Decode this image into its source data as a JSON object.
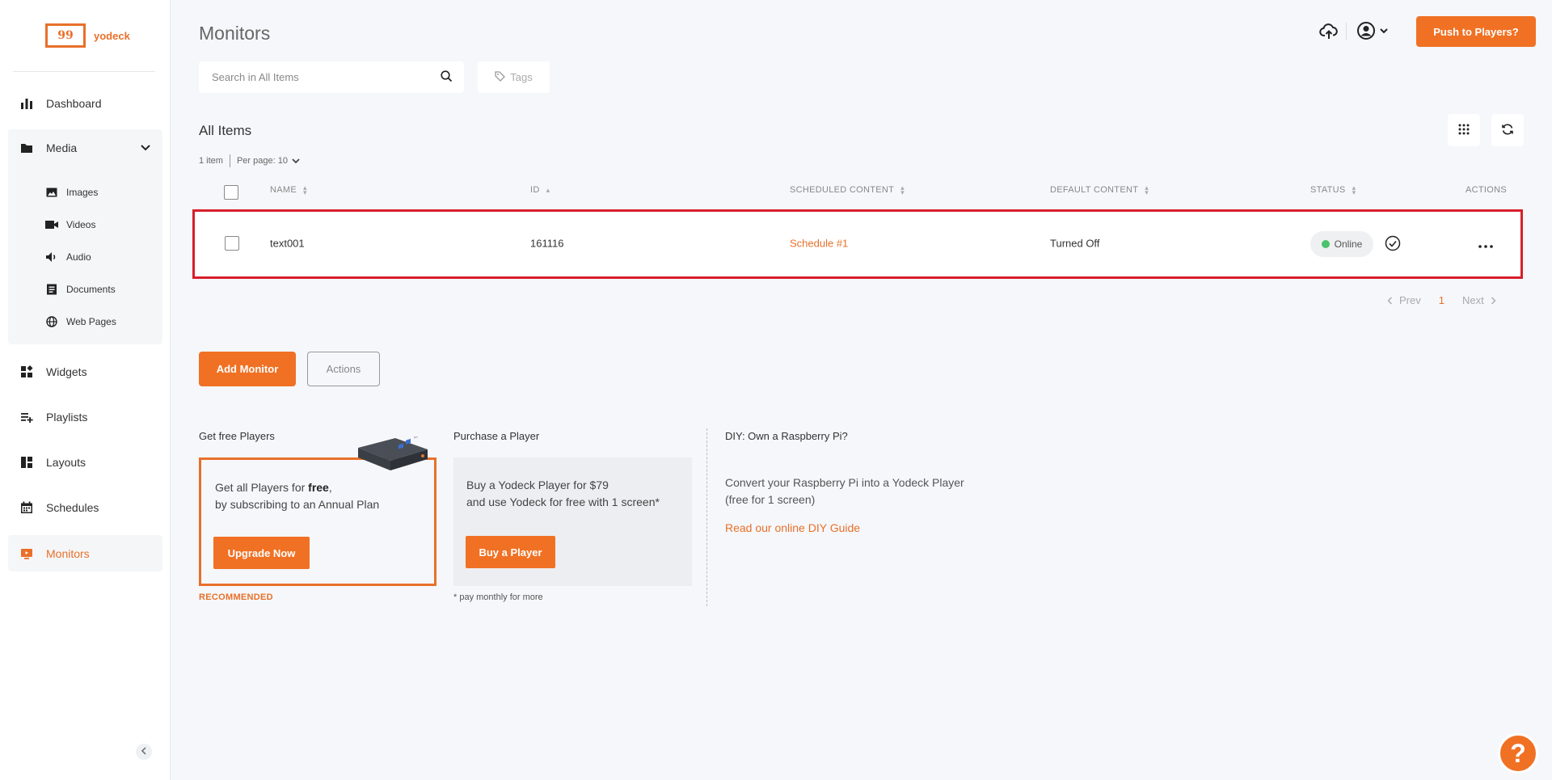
{
  "logo": {
    "mark": "99",
    "text": "yodeck"
  },
  "sidebar": {
    "items": [
      {
        "label": "Dashboard"
      },
      {
        "label": "Media"
      },
      {
        "label": "Widgets"
      },
      {
        "label": "Playlists"
      },
      {
        "label": "Layouts"
      },
      {
        "label": "Schedules"
      },
      {
        "label": "Monitors"
      }
    ],
    "media_sub": [
      {
        "label": "Images"
      },
      {
        "label": "Videos"
      },
      {
        "label": "Audio"
      },
      {
        "label": "Documents"
      },
      {
        "label": "Web Pages"
      }
    ]
  },
  "header": {
    "title": "Monitors",
    "push_label": "Push to Players?"
  },
  "search": {
    "placeholder": "Search in All Items"
  },
  "tags_label": "Tags",
  "list": {
    "title": "All Items",
    "count_text": "1 item",
    "per_page_text": "Per page: 10"
  },
  "table": {
    "headers": {
      "name": "NAME",
      "id": "ID",
      "scheduled": "SCHEDULED CONTENT",
      "default": "DEFAULT CONTENT",
      "status": "STATUS",
      "actions": "ACTIONS"
    },
    "rows": [
      {
        "name": "text001",
        "id": "161116",
        "scheduled": "Schedule #1",
        "default": "Turned Off",
        "status": "Online"
      }
    ]
  },
  "pager": {
    "prev": "Prev",
    "page": "1",
    "next": "Next"
  },
  "buttons": {
    "add_monitor": "Add Monitor",
    "actions": "Actions"
  },
  "promo": {
    "free": {
      "heading": "Get free Players",
      "line1_pre": "Get all Players for ",
      "line1_bold": "free",
      "line1_post": ",",
      "line2": "by subscribing to an Annual Plan",
      "button": "Upgrade Now",
      "badge": "RECOMMENDED"
    },
    "purchase": {
      "heading": "Purchase a Player",
      "line1": "Buy a Yodeck Player for $79",
      "line2": "and use Yodeck for free with 1 screen*",
      "button": "Buy a Player",
      "footnote": "* pay monthly for more"
    },
    "diy": {
      "heading": "DIY: Own a Raspberry Pi?",
      "text": "Convert your Raspberry Pi into a Yodeck Player (free for 1 screen)",
      "link": "Read our online DIY Guide"
    }
  },
  "help": {
    "label": "?"
  },
  "colors": {
    "accent": "#f07124",
    "highlight": "#d71f2a",
    "online": "#4cc16b"
  }
}
